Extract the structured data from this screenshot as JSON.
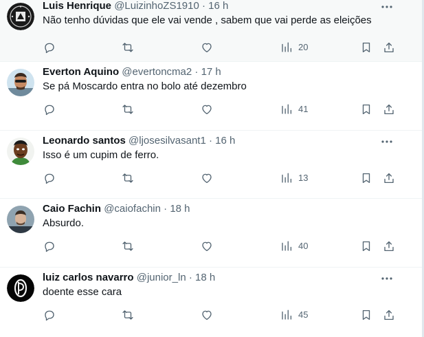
{
  "tweets": [
    {
      "name": "Luis Henrique",
      "handle": "@LuizinhoZS1910",
      "dot": "·",
      "time": "16 h",
      "text": "Não tenho dúvidas que ele vai vende , sabem que vai perde as eleições",
      "views": "20",
      "avatar": "black-white-logo"
    },
    {
      "name": "Everton Aquino",
      "handle": "@evertoncma2",
      "dot": "·",
      "time": "17 h",
      "text": "Se pá Moscardo entra no bolo até dezembro",
      "views": "41",
      "avatar": "man-sunglasses-photo"
    },
    {
      "name": "Leonardo santos",
      "handle": "@ljosesilvasant1",
      "dot": "·",
      "time": "16 h",
      "text": "Isso é um cupim de ferro.",
      "views": "13",
      "avatar": "cartoon-man-green"
    },
    {
      "name": "Caio Fachin",
      "handle": "@caiofachin",
      "dot": "·",
      "time": "18 h",
      "text": "Absurdo.",
      "views": "40",
      "avatar": "man-photo"
    },
    {
      "name": "luiz carlos navarro",
      "handle": "@junior_ln",
      "dot": "·",
      "time": "18 h",
      "text": "doente esse cara",
      "views": "45",
      "avatar": "black-circle-monogram"
    }
  ],
  "icons": [
    "more-icon",
    "reply-icon",
    "retweet-icon",
    "like-icon",
    "views-icon",
    "bookmark-icon",
    "share-icon"
  ],
  "colors": {
    "text": "#0f1419",
    "secondary": "#536471",
    "divider": "#eff3f4",
    "highlight_bg": "#f7f9f9"
  }
}
